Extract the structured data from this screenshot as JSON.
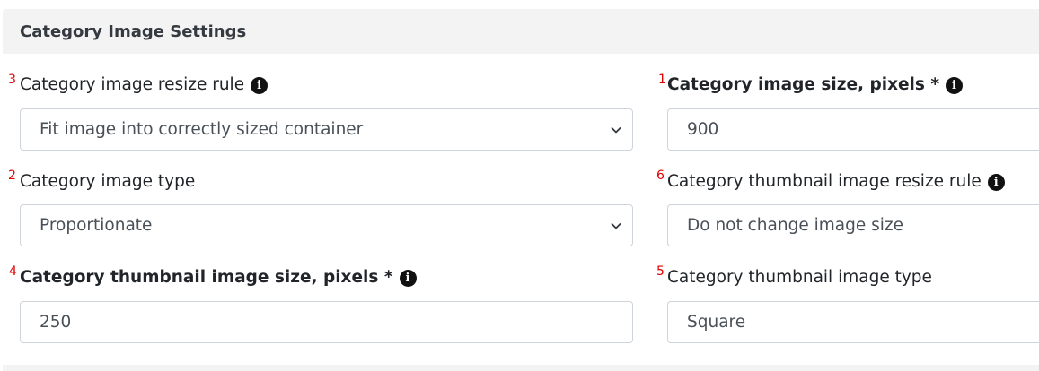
{
  "header": {
    "title": "Category Image Settings"
  },
  "fields": {
    "resize_rule": {
      "num": "3",
      "label": "Category image resize rule",
      "value": "Fit image into correctly sized container"
    },
    "image_size": {
      "num": "1",
      "label": "Category image size, pixels *",
      "value": "900"
    },
    "image_type": {
      "num": "2",
      "label": "Category image type",
      "value": "Proportionate"
    },
    "thumb_resize_rule": {
      "num": "6",
      "label": "Category thumbnail image resize rule",
      "value": "Do not change image size"
    },
    "thumb_size": {
      "num": "4",
      "label": "Category thumbnail image size, pixels *",
      "value": "250"
    },
    "thumb_type": {
      "num": "5",
      "label": "Category thumbnail image type",
      "value": "Square"
    }
  },
  "icons": {
    "info": "info-circle-icon",
    "dropdown": "chevron-down-icon"
  },
  "colors": {
    "header_bg": "#f3f3f4",
    "number_marker": "#e00000",
    "border": "#ced4da"
  }
}
